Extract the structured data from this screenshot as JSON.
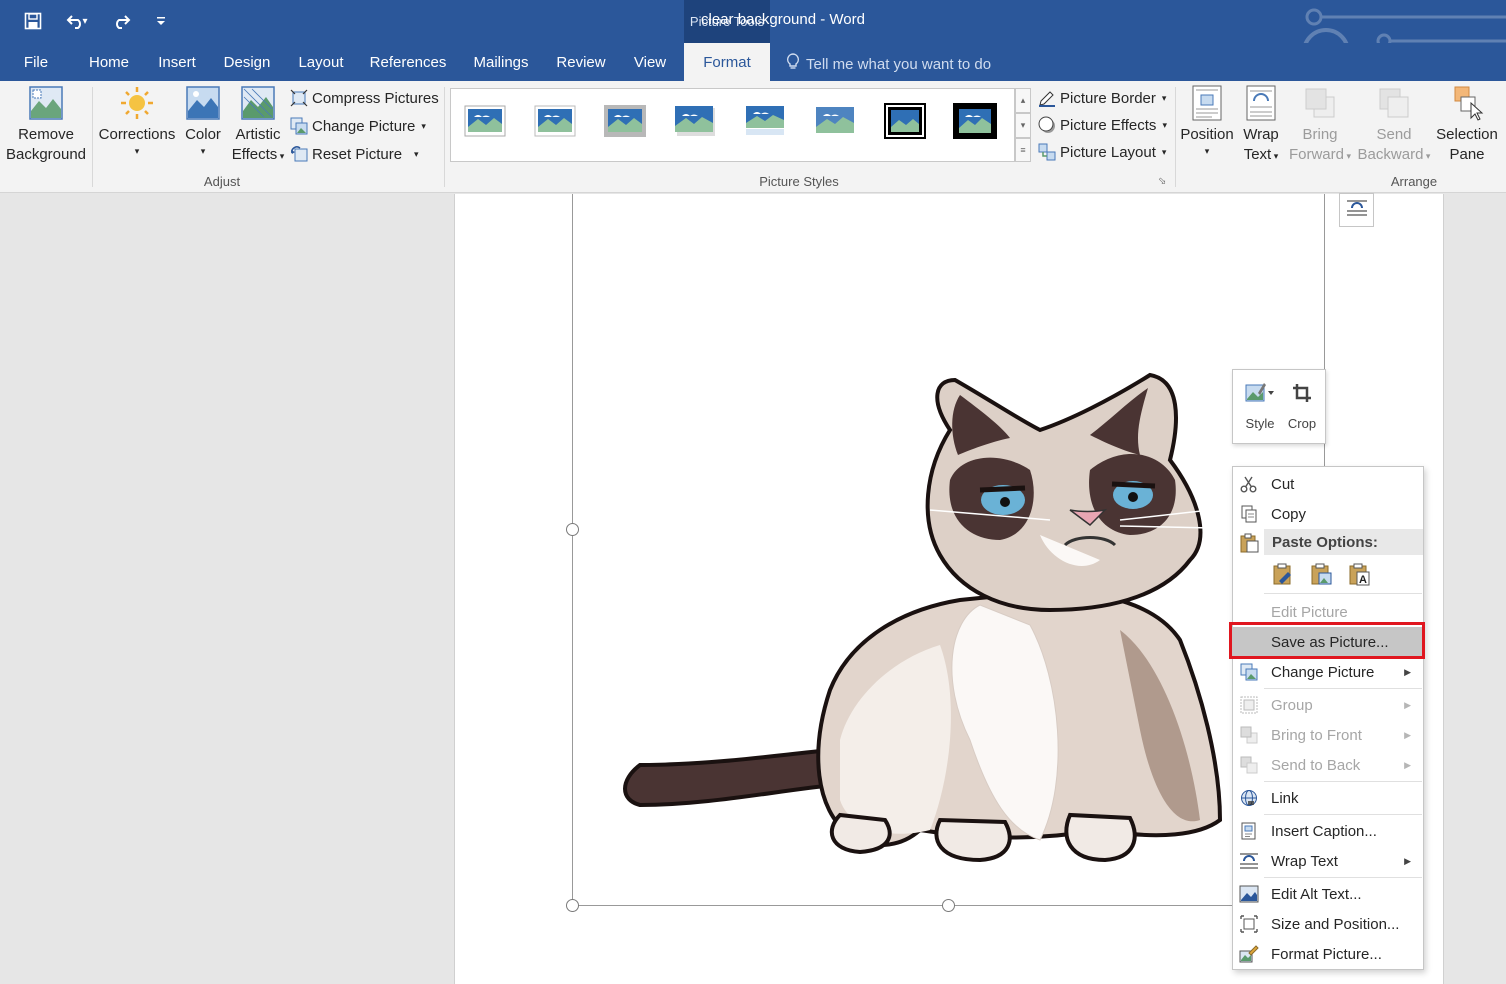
{
  "titlebar": {
    "document_title": "clear background  -  Word",
    "contextual_group": "Picture Tools"
  },
  "tabs": [
    {
      "label": "File"
    },
    {
      "label": "Home"
    },
    {
      "label": "Insert"
    },
    {
      "label": "Design"
    },
    {
      "label": "Layout"
    },
    {
      "label": "References"
    },
    {
      "label": "Mailings"
    },
    {
      "label": "Review"
    },
    {
      "label": "View"
    },
    {
      "label": "Format"
    }
  ],
  "tellme": {
    "placeholder": "Tell me what you want to do"
  },
  "ribbon": {
    "adjust": {
      "label": "Adjust",
      "remove_background_1": "Remove",
      "remove_background_2": "Background",
      "corrections": "Corrections",
      "color": "Color",
      "artistic_1": "Artistic",
      "artistic_2": "Effects",
      "compress": "Compress Pictures",
      "change": "Change Picture",
      "reset": "Reset Picture"
    },
    "styles": {
      "label": "Picture Styles",
      "border": "Picture Border",
      "effects": "Picture Effects",
      "layout": "Picture Layout"
    },
    "arrange": {
      "label": "Arrange",
      "position": "Position",
      "wrap_1": "Wrap",
      "wrap_2": "Text",
      "bring_1": "Bring",
      "bring_2": "Forward",
      "send_1": "Send",
      "send_2": "Backward",
      "selection_1": "Selection",
      "selection_2": "Pane"
    }
  },
  "minibar": {
    "style": "Style",
    "crop": "Crop"
  },
  "context_menu": {
    "cut": "Cut",
    "copy": "Copy",
    "paste_options": "Paste Options:",
    "edit_picture": "Edit Picture",
    "save_as_picture": "Save as Picture...",
    "change_picture": "Change Picture",
    "group": "Group",
    "bring_to_front": "Bring to Front",
    "send_to_back": "Send to Back",
    "link": "Link",
    "insert_caption": "Insert Caption...",
    "wrap_text": "Wrap Text",
    "edit_alt_text": "Edit Alt Text...",
    "size_and_position": "Size and Position...",
    "format_picture": "Format Picture..."
  },
  "colors": {
    "word_blue": "#2b579a",
    "highlight_red": "#e0161f"
  }
}
